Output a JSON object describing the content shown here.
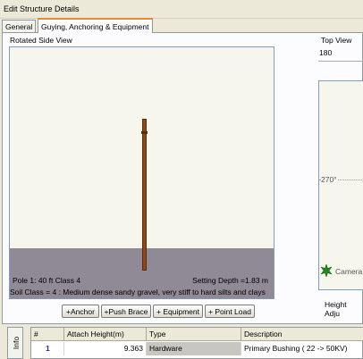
{
  "window": {
    "title": "Edit Structure Details"
  },
  "tabs": [
    {
      "label": "General"
    },
    {
      "label": "Guying, Anchoring & Equipment"
    }
  ],
  "side_view": {
    "label": "Rotated Side View",
    "pole_info": "Pole 1: 40 ft Class 4",
    "setting_depth": "Setting Depth =1.83 m",
    "soil_class": "Soil Class = 4 : Medium dense sandy gravel, very stiff to hard silts and clays"
  },
  "top_view": {
    "label": "Top View",
    "degree_top": "180",
    "degree_left": "270°",
    "camera_label": "Camera",
    "height_adjust_label": "Height Adju"
  },
  "buttons": {
    "anchor": "+Anchor",
    "push_brace": "+Push Brace",
    "equipment": "+ Equipment",
    "point_load": "+ Point Load"
  },
  "info_tab": {
    "label": "Info"
  },
  "grid": {
    "headers": [
      "#",
      "Attach Height(m)",
      "Type",
      "Description"
    ],
    "rows": [
      {
        "num": "1",
        "height": "9.363",
        "type": "Hardware",
        "description": "Primary Bushing ( 22 -> 50KV)"
      }
    ]
  },
  "colors": {
    "pole": "#8b4a1c",
    "ground": "#8f8a95",
    "tab_accent": "#e68b2c",
    "camera": "#1c8a1c"
  }
}
